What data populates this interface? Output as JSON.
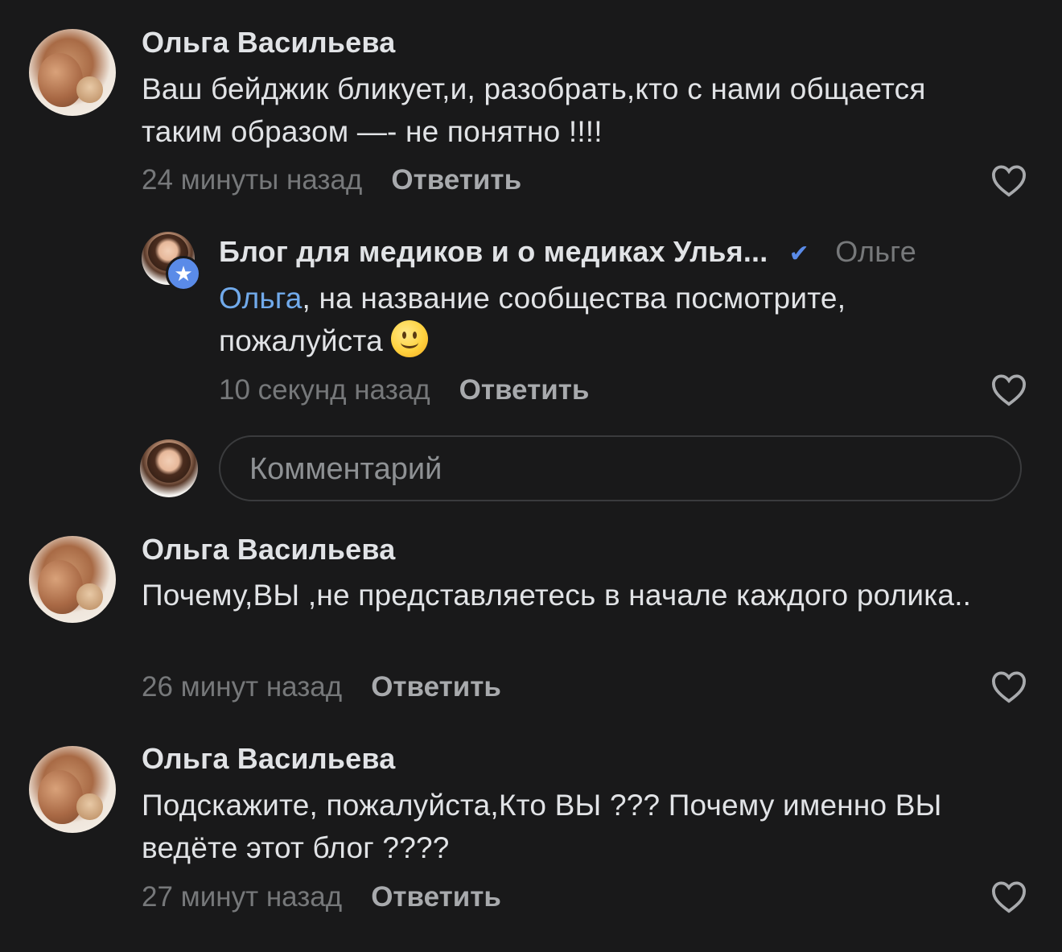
{
  "comments": [
    {
      "author": "Ольга Васильева",
      "text": "Ваш бейджик бликует,и, разобрать,кто с нами общается таким образом —- не понятно !!!!",
      "time": "24 минуты назад",
      "reply_label": "Ответить",
      "reply": {
        "author": "Блог для медиков и о медиках Улья...",
        "to": "Ольге",
        "mention": "Ольга",
        "text": ", на название сообщества посмотрите, пожалуйста",
        "time": "10 секунд назад",
        "reply_label": "Ответить"
      },
      "comment_input": {
        "placeholder": "Комментарий"
      }
    },
    {
      "author": "Ольга Васильева",
      "text": "Почему,ВЫ ,не представляетесь в начале каждого ролика..",
      "time": "26 минут назад",
      "reply_label": "Ответить"
    },
    {
      "author": "Ольга Васильева",
      "text": "Подскажите, пожалуйста,Кто ВЫ ??? Почему именно ВЫ ведёте этот блог ????",
      "time": "27 минут назад",
      "reply_label": "Ответить"
    }
  ],
  "icons": {
    "like": "heart-outline-icon",
    "verified": "checkmark-icon",
    "badge": "star-icon",
    "emoji": "slightly-smiling-face"
  },
  "colors": {
    "background": "#19191a",
    "text": "#e1e3e6",
    "secondary": "#76787a",
    "accent": "#71aaeb",
    "badge": "#5a8be8"
  }
}
